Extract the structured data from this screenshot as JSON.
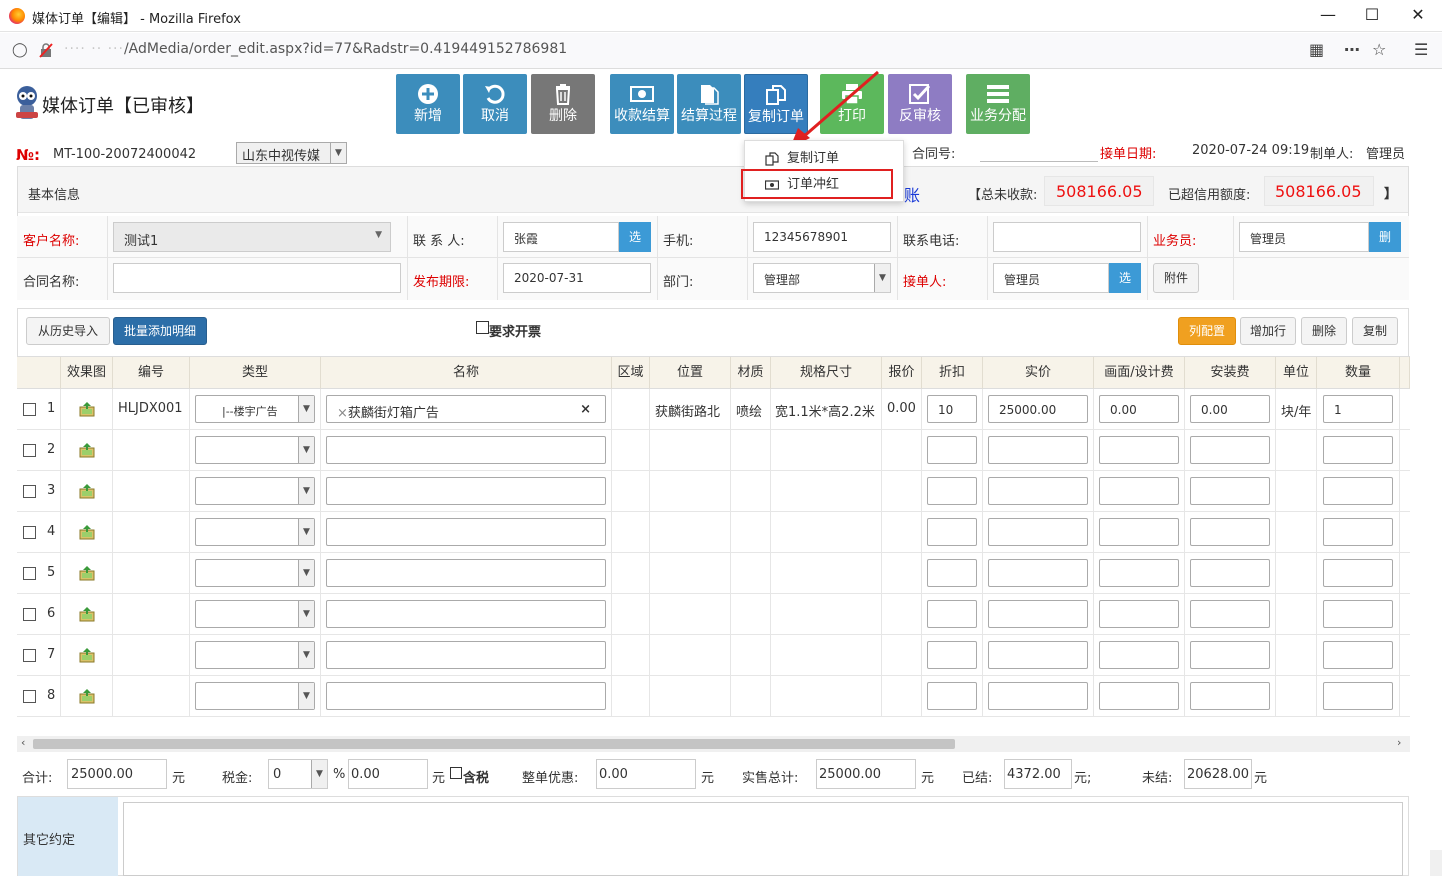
{
  "browser": {
    "window_title": "媒体订单【编辑】 - Mozilla Firefox",
    "url_host": "···· ·· ···",
    "url_path": "/AdMedia/order_edit.aspx?id=77&Radstr=0.419449152786981"
  },
  "header": {
    "title": "媒体订单【已审核】",
    "toolbar": [
      {
        "label": "新增",
        "icon": "plus-circle-icon"
      },
      {
        "label": "取消",
        "icon": "undo-icon"
      },
      {
        "label": "删除",
        "icon": "trash-icon"
      },
      {
        "label": "收款结算",
        "icon": "money-icon"
      },
      {
        "label": "结算过程",
        "icon": "documents-icon"
      },
      {
        "label": "复制订单",
        "icon": "copy-icon"
      },
      {
        "label": "打印",
        "icon": "print-icon"
      },
      {
        "label": "反审核",
        "icon": "check-square-icon"
      },
      {
        "label": "业务分配",
        "icon": "list-icon"
      }
    ]
  },
  "dropdown_menu": {
    "items": [
      {
        "label": "复制订单",
        "icon": "copy-icon"
      },
      {
        "label": "订单冲红",
        "icon": "money-icon"
      }
    ]
  },
  "order_info": {
    "no_label": "№:",
    "no_value": "MT-100-20072400042",
    "media_company": "山东中视传媒",
    "contract_no_label": "合同号:",
    "receive_date_label": "接单日期:",
    "receive_date_value": "2020-07-24 09:19",
    "creator_label": "制单人:",
    "creator_value": "管理员"
  },
  "basic_info": {
    "section_label": "基本信息",
    "partial_status": "账",
    "total_unreceived_label": "【总未收款:",
    "total_unreceived_value": "508166.05",
    "over_credit_label": "已超信用额度:",
    "over_credit_value": "508166.05",
    "close_bracket": "】",
    "customer_label": "客户名称:",
    "customer_value": "测试1",
    "contact_label": "联 系 人:",
    "contact_value": "张霞",
    "phone_label": "手机:",
    "phone_value": "12345678901",
    "tel_label": "联系电话:",
    "tel_value": "",
    "salesman_label": "业务员:",
    "salesman_value": "管理员",
    "contract_name_label": "合同名称:",
    "contract_name_value": "",
    "publish_label": "发布期限:",
    "publish_value": "2020-07-31",
    "dept_label": "部门:",
    "dept_value": "管理部",
    "receiver_label": "接单人:",
    "receiver_value": "管理员",
    "select_btn": "选",
    "delete_btn": "删",
    "attachment_btn": "附件"
  },
  "detail_toolbar": {
    "import_history": "从历史导入",
    "batch_add": "批量添加明细",
    "invoice_label": "要求开票",
    "column_config": "列配置",
    "add_row": "增加行",
    "delete": "删除",
    "copy": "复制"
  },
  "table": {
    "headers": [
      "效果图",
      "编号",
      "类型",
      "名称",
      "区域",
      "位置",
      "材质",
      "规格尺寸",
      "报价",
      "折扣",
      "实价",
      "画面/设计费",
      "安装费",
      "单位",
      "数量"
    ],
    "rows": [
      {
        "num": "1",
        "code": "HLJDX001",
        "type": "|--楼宇广告",
        "name": "获麟街灯箱广告",
        "area": "",
        "position": "获麟街路北",
        "material": "喷绘",
        "size": "宽1.1米*高2.2米",
        "quote": "0.00",
        "discount": "10",
        "price": "25000.00",
        "design_fee": "0.00",
        "install_fee": "0.00",
        "unit": "块/年",
        "qty": "1"
      },
      {
        "num": "2"
      },
      {
        "num": "3"
      },
      {
        "num": "4"
      },
      {
        "num": "5"
      },
      {
        "num": "6"
      },
      {
        "num": "7"
      },
      {
        "num": "8"
      }
    ]
  },
  "totals": {
    "sum_label": "合计:",
    "sum_value": "25000.00",
    "yuan": "元",
    "tax_label": "税金:",
    "tax_rate": "0",
    "percent": "%",
    "tax_value": "0.00",
    "tax_included_label": "含税",
    "discount_label": "整单优惠:",
    "discount_value": "0.00",
    "actual_total_label": "实售总计:",
    "actual_total_value": "25000.00",
    "settled_label": "已结:",
    "settled_value": "4372.00",
    "yuan_comma": "元;",
    "unsettled_label": "未结:",
    "unsettled_value": "20628.00"
  },
  "other": {
    "label": "其它约定",
    "value": ""
  },
  "colors": {
    "toolbar_blue": "#3c8dbc",
    "toolbar_gray": "#777777",
    "toolbar_green": "#5cb85c",
    "toolbar_purple": "#8e7cc3",
    "required_red": "#dd0000",
    "amount_red": "#ee1111",
    "orange_button": "#f0a020",
    "annotation_red": "#e02020"
  }
}
